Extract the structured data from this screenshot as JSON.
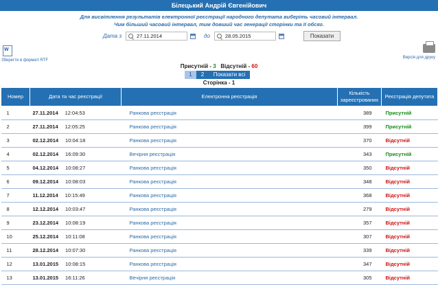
{
  "header": {
    "title": "Білецький Андрій Євгенійович"
  },
  "info": {
    "line1": "Для висвітлення результатів електронної реєстрації народного депутата виберіть часовий інтервал.",
    "line2": "Чим більший часовий інтервал, тим довший час генерації сторінки та її обсяг."
  },
  "filter": {
    "from_label": "Дата з",
    "from_value": "27.11.2014",
    "to_label": "до",
    "to_value": "28.05.2015",
    "show_button": "Показати"
  },
  "export": {
    "rtf_label": "Зберегти в форматі RTF",
    "print_label": "Версія для друку"
  },
  "summary": {
    "present_label": "Присутній -",
    "present_count": "3",
    "absent_label": "Відсутній -",
    "absent_count": "60"
  },
  "pagination": {
    "pages": [
      "1",
      "2"
    ],
    "show_all": "Показати всі",
    "current_page_text": "Сторінка - 1"
  },
  "table": {
    "headers": [
      "Номер",
      "Дата та час реєстрації",
      "Електронна реєстрація",
      "Кількість зареєстрованих",
      "Реєстрація депутата"
    ],
    "rows": [
      {
        "num": "1",
        "date": "27.11.2014",
        "time": "12:04:53",
        "type": "Ранкова реєстрація",
        "count": "389",
        "status": "Присутній",
        "status_type": "present"
      },
      {
        "num": "2",
        "date": "27.11.2014",
        "time": "12:05:25",
        "type": "Ранкова реєстрація",
        "count": "399",
        "status": "Присутній",
        "status_type": "present"
      },
      {
        "num": "3",
        "date": "02.12.2014",
        "time": "10:04:18",
        "type": "Ранкова реєстрація",
        "count": "370",
        "status": "Відсутній",
        "status_type": "absent"
      },
      {
        "num": "4",
        "date": "02.12.2014",
        "time": "16:09:30",
        "type": "Вечірня реєстрація",
        "count": "343",
        "status": "Присутній",
        "status_type": "present"
      },
      {
        "num": "5",
        "date": "04.12.2014",
        "time": "10:08:27",
        "type": "Ранкова реєстрація",
        "count": "350",
        "status": "Відсутній",
        "status_type": "absent"
      },
      {
        "num": "6",
        "date": "09.12.2014",
        "time": "10:08:03",
        "type": "Ранкова реєстрація",
        "count": "348",
        "status": "Відсутній",
        "status_type": "absent"
      },
      {
        "num": "7",
        "date": "11.12.2014",
        "time": "10:15:49",
        "type": "Ранкова реєстрація",
        "count": "368",
        "status": "Відсутній",
        "status_type": "absent"
      },
      {
        "num": "8",
        "date": "12.12.2014",
        "time": "10:03:47",
        "type": "Ранкова реєстрація",
        "count": "279",
        "status": "Відсутній",
        "status_type": "absent"
      },
      {
        "num": "9",
        "date": "23.12.2014",
        "time": "10:08:19",
        "type": "Ранкова реєстрація",
        "count": "357",
        "status": "Відсутній",
        "status_type": "absent"
      },
      {
        "num": "10",
        "date": "25.12.2014",
        "time": "10:11:08",
        "type": "Ранкова реєстрація",
        "count": "307",
        "status": "Відсутній",
        "status_type": "absent"
      },
      {
        "num": "11",
        "date": "28.12.2014",
        "time": "10:07:30",
        "type": "Ранкова реєстрація",
        "count": "339",
        "status": "Відсутній",
        "status_type": "absent"
      },
      {
        "num": "12",
        "date": "13.01.2015",
        "time": "10:08:15",
        "type": "Ранкова реєстрація",
        "count": "347",
        "status": "Відсутній",
        "status_type": "absent"
      },
      {
        "num": "13",
        "date": "13.01.2015",
        "time": "16:11:26",
        "type": "Вечірня реєстрація",
        "count": "305",
        "status": "Відсутній",
        "status_type": "absent"
      }
    ]
  }
}
